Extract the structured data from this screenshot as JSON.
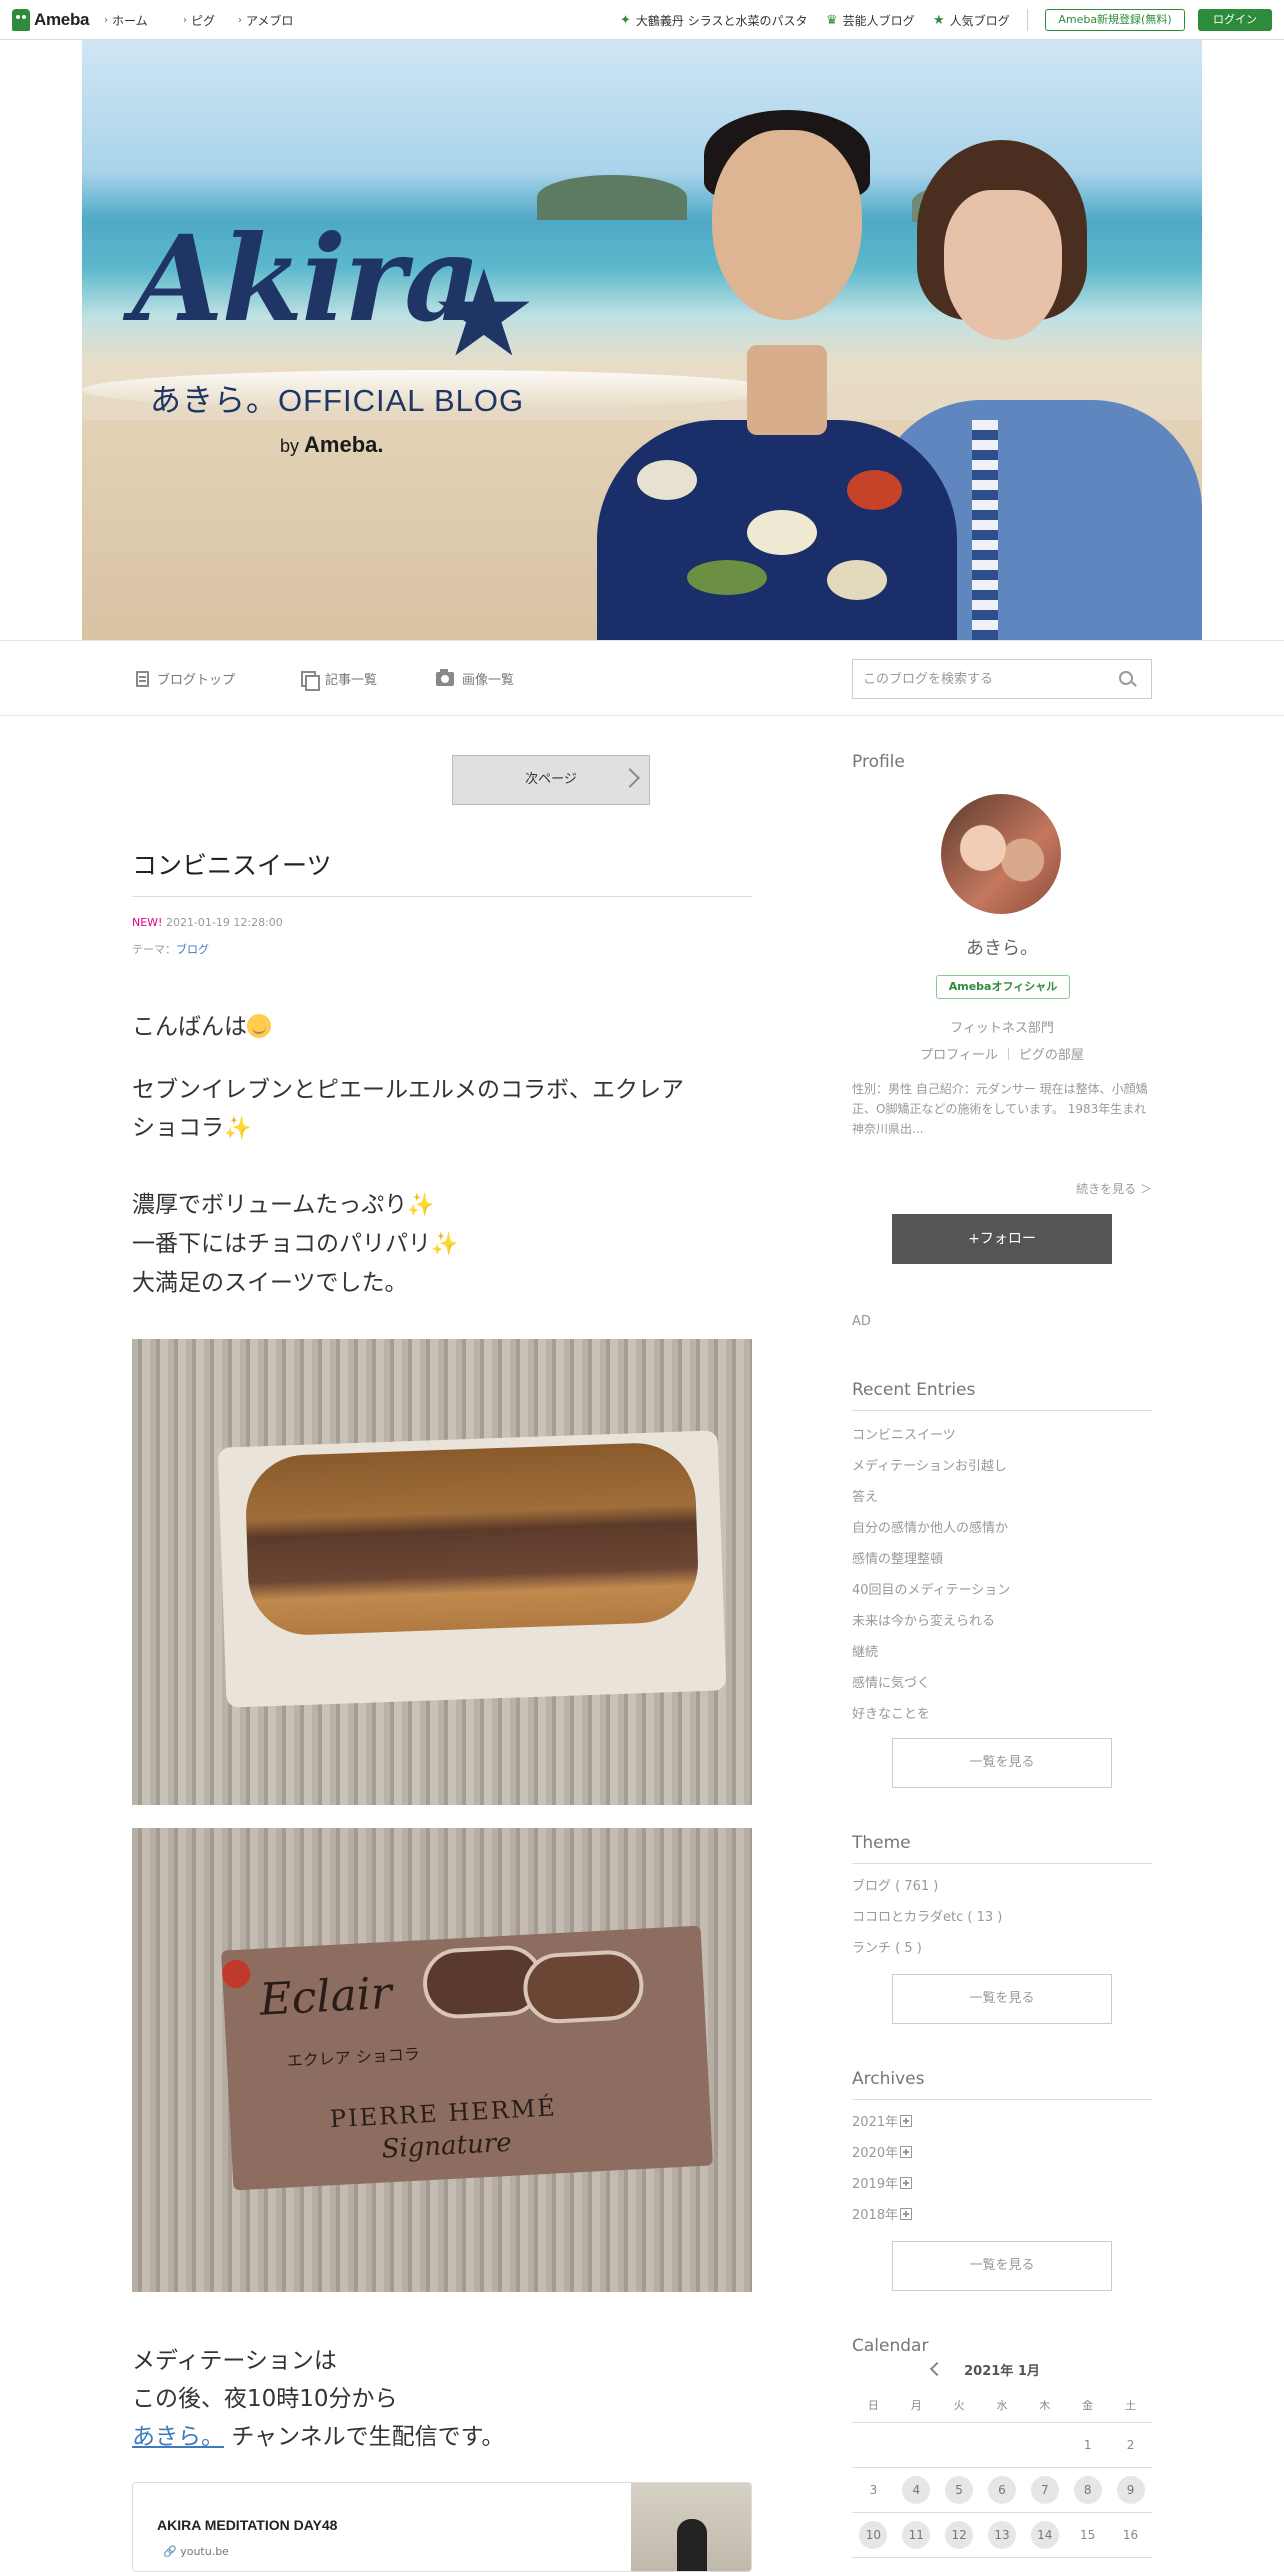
{
  "topbar": {
    "logo": "Ameba",
    "nav": [
      "ホーム",
      "ピグ",
      "アメブロ"
    ],
    "promo": "大鶴義丹 シラスと水菜のパスタ",
    "celeb": "芸能人ブログ",
    "popular": "人気ブログ",
    "register": "Ameba新規登録(無料)",
    "login": "ログイン"
  },
  "header": {
    "title": "Akira",
    "subtitle": "あきら。OFFICIAL BLOG",
    "by": "by",
    "brand": "Ameba."
  },
  "blognav": {
    "top": "ブログトップ",
    "entries": "記事一覧",
    "images": "画像一覧",
    "search_placeholder": "このブログを検索する"
  },
  "post": {
    "next_page": "次ページ",
    "title": "コンビニスイーツ",
    "new_label": "NEW!",
    "datetime": "2021-01-19 12:28:00",
    "theme_label": "テーマ：",
    "theme": "ブログ",
    "p1": "こんばんは",
    "p2a": "セブンイレブンとピエールエルメのコラボ、エクレア",
    "p2b": "ショコラ",
    "p3a": "濃厚でボリュームたっぷり",
    "p3b": "一番下にはチョコのパリパリ",
    "p3c": "大満足のスイーツでした。",
    "photo2_brand": "Eclair",
    "photo2_kata": "エクレア ショコラ",
    "photo2_maker": "PIERRE HERMÉ",
    "photo2_sig": "Signature",
    "p4a": "メディテーションは",
    "p4b": "この後、夜10時10分から",
    "p4_link": "あきら。",
    "p4c": "チャンネルで生配信です。",
    "card_title": "AKIRA MEDITATION DAY48",
    "card_domain": "youtu.be"
  },
  "sidebar": {
    "profile_heading": "Profile",
    "name": "あきら。",
    "badge": "Amebaオフィシャル",
    "category": "フィットネス部門",
    "link_profile": "プロフィール",
    "link_room": "ピグの部屋",
    "desc": "性別：男性 自己紹介：元ダンサー 現在は整体、小顔矯正、O脚矯正などの施術をしています。 1983年生まれ 神奈川県出...",
    "more": "続きを見る ＞",
    "follow": "+フォロー",
    "ad": "AD",
    "recent_heading": "Recent Entries",
    "recent": [
      "コンビニスイーツ",
      "メディテーションお引越し",
      "答え",
      "自分の感情か他人の感情か",
      "感情の整理整頓",
      "40回目のメディテーション",
      "未来は今から変えられる",
      "継続",
      "感情に気づく",
      "好きなことを"
    ],
    "see_all": "一覧を見る",
    "theme_heading": "Theme",
    "themes": [
      "ブログ ( 761 )",
      "ココロとカラダetc ( 13 )",
      "ランチ ( 5 )"
    ],
    "archives_heading": "Archives",
    "archives": [
      "2021年",
      "2020年",
      "2019年",
      "2018年"
    ],
    "calendar_heading": "Calendar",
    "calendar_month": "2021年 1月",
    "weekdays": [
      "日",
      "月",
      "火",
      "水",
      "木",
      "金",
      "土"
    ],
    "weeks": [
      [
        "",
        "",
        "",
        "",
        "",
        "1",
        "2"
      ],
      [
        "3",
        "4",
        "5",
        "6",
        "7",
        "8",
        "9"
      ],
      [
        "10",
        "11",
        "12",
        "13",
        "14",
        "15",
        "16"
      ]
    ],
    "entry_days": [
      "4",
      "5",
      "6",
      "7",
      "8",
      "9",
      "10",
      "11",
      "12",
      "13",
      "14"
    ]
  }
}
